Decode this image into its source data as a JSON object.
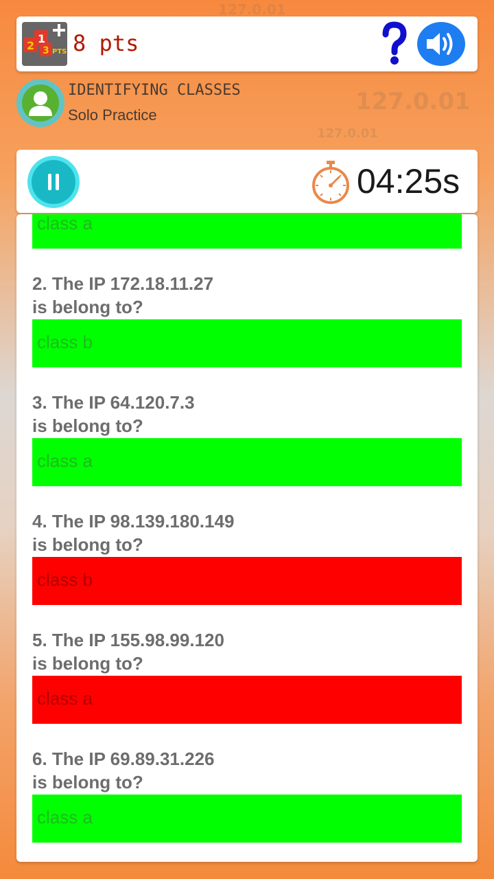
{
  "header": {
    "points": "8 pts",
    "pts_icon_label": "PTS"
  },
  "mode": {
    "title": "IDENTIFYING CLASSES",
    "subtitle": "Solo Practice"
  },
  "timer": {
    "value": "04:25s"
  },
  "previous_answer": {
    "text": "class a",
    "status": "correct"
  },
  "questions": [
    {
      "number_line": "2. The IP 172.18.11.27",
      "line2": "is belong to?",
      "answer": "class b",
      "status": "correct"
    },
    {
      "number_line": "3. The IP 64.120.7.3",
      "line2": "is belong to?",
      "answer": "class a",
      "status": "correct"
    },
    {
      "number_line": "4. The IP 98.139.180.149",
      "line2": "is belong to?",
      "answer": "class b",
      "status": "wrong"
    },
    {
      "number_line": "5. The IP 155.98.99.120",
      "line2": "is belong to?",
      "answer": "class a",
      "status": "wrong"
    },
    {
      "number_line": "6. The IP 69.89.31.226",
      "line2": "is belong to?",
      "answer": "class a",
      "status": "correct"
    }
  ],
  "background_text": [
    "127.0.01",
    "127.0.01",
    "127.0.01"
  ],
  "colors": {
    "correct": "#00ff00",
    "wrong": "#ff0000",
    "accent_blue": "#1e7df0",
    "pause_teal": "#18b9c5",
    "points_red": "#b01a00"
  },
  "icons": [
    "points-badge-icon",
    "help-icon",
    "sound-icon",
    "user-avatar-icon",
    "pause-icon",
    "stopwatch-icon"
  ]
}
